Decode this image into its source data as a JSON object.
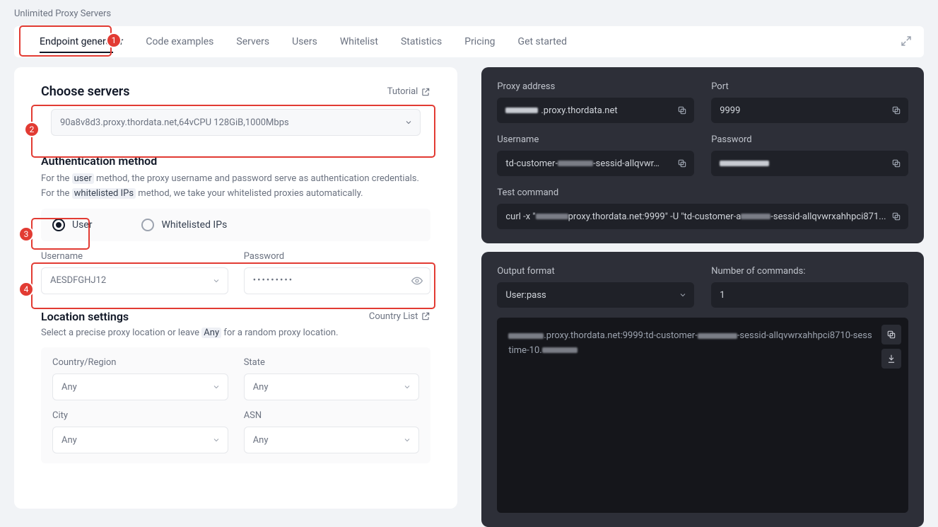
{
  "page_title": "Unlimited Proxy Servers",
  "tabs": {
    "items": [
      "Endpoint generator",
      "Code examples",
      "Servers",
      "Users",
      "Whitelist",
      "Statistics",
      "Pricing",
      "Get started"
    ],
    "active_index": 0
  },
  "choose_servers": {
    "title": "Choose servers",
    "tutorial_label": "Tutorial",
    "server_value": "90a8v8d3.proxy.thordata.net,64vCPU 128GiB,1000Mbps"
  },
  "auth": {
    "title": "Authentication method",
    "desc_before": "For the ",
    "desc_user": "user",
    "desc_mid": " method, the proxy username and password serve as authentication credentials. For the ",
    "desc_whitelist": "whitelisted IPs",
    "desc_after": " method, we take your whitelisted proxies automatically.",
    "radio_user": "User",
    "radio_whitelist": "Whitelisted IPs",
    "username_label": "Username",
    "username_value": "AESDFGHJ12",
    "password_label": "Password",
    "password_masked": "•••••••••"
  },
  "location": {
    "title": "Location settings",
    "country_list_label": "Country List",
    "desc_before": "Select a precise proxy location or leave ",
    "desc_any": "Any",
    "desc_after": " for a random proxy location.",
    "fields": {
      "country_label": "Country/Region",
      "country_value": "Any",
      "state_label": "State",
      "state_value": "Any",
      "city_label": "City",
      "city_value": "Any",
      "asn_label": "ASN",
      "asn_value": "Any"
    }
  },
  "cred_panel": {
    "proxy_address_label": "Proxy address",
    "proxy_address_value": ".proxy.thordata.net",
    "port_label": "Port",
    "port_value": "9999",
    "username_label": "Username",
    "username_prefix": "td-customer-",
    "username_suffix": "-sessid-allqvwr…",
    "password_label": "Password",
    "test_cmd_label": "Test command",
    "test_cmd_pre": "curl -x \"",
    "test_cmd_mid": "proxy.thordata.net:9999\" -U \"td-customer-a",
    "test_cmd_suf": "-sessid-allqvwrxahhpci871..."
  },
  "output_panel": {
    "format_label": "Output format",
    "format_value": "User:pass",
    "num_label": "Number of commands:",
    "num_value": "1",
    "output_pre": ".proxy.thordata.net:9999:td-customer-",
    "output_mid": "-sessid-allqvwrxahhpci8710-sesstime-",
    "output_suf": "10."
  },
  "badges": {
    "b1": "1",
    "b2": "2",
    "b3": "3",
    "b4": "4"
  }
}
